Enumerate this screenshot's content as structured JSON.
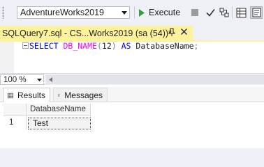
{
  "toolbar": {
    "database_selected": "AdventureWorks2019",
    "execute_label": "Execute"
  },
  "document_tab": {
    "title": "SQLQuery7.sql - CS...Works2019 (sa (54))*"
  },
  "editor": {
    "query": {
      "keyword_select": "SELECT",
      "function_name": "DB_NAME",
      "open_paren": "(",
      "argument": "12",
      "close_paren": ")",
      "keyword_as": "AS",
      "alias": "DatabaseName",
      "terminator": ";"
    }
  },
  "zoom": {
    "value": "100 %"
  },
  "results": {
    "tabs": [
      {
        "label": "Results",
        "active": true
      },
      {
        "label": "Messages",
        "active": false
      }
    ],
    "columns": [
      "DatabaseName"
    ],
    "rows": [
      {
        "number": "1",
        "cells": [
          "Test"
        ]
      }
    ]
  },
  "icons": {
    "execute": "play-icon",
    "stop": "stop-icon",
    "parse": "checkmark-icon",
    "plan": "query-plan-icon",
    "grid": "results-to-grid-icon",
    "text": "results-to-text-icon"
  },
  "colors": {
    "tab_highlight": "#fff29d",
    "keyword": "#0000ff",
    "function": "#ff00ff",
    "execute_green": "#2f9e44"
  }
}
